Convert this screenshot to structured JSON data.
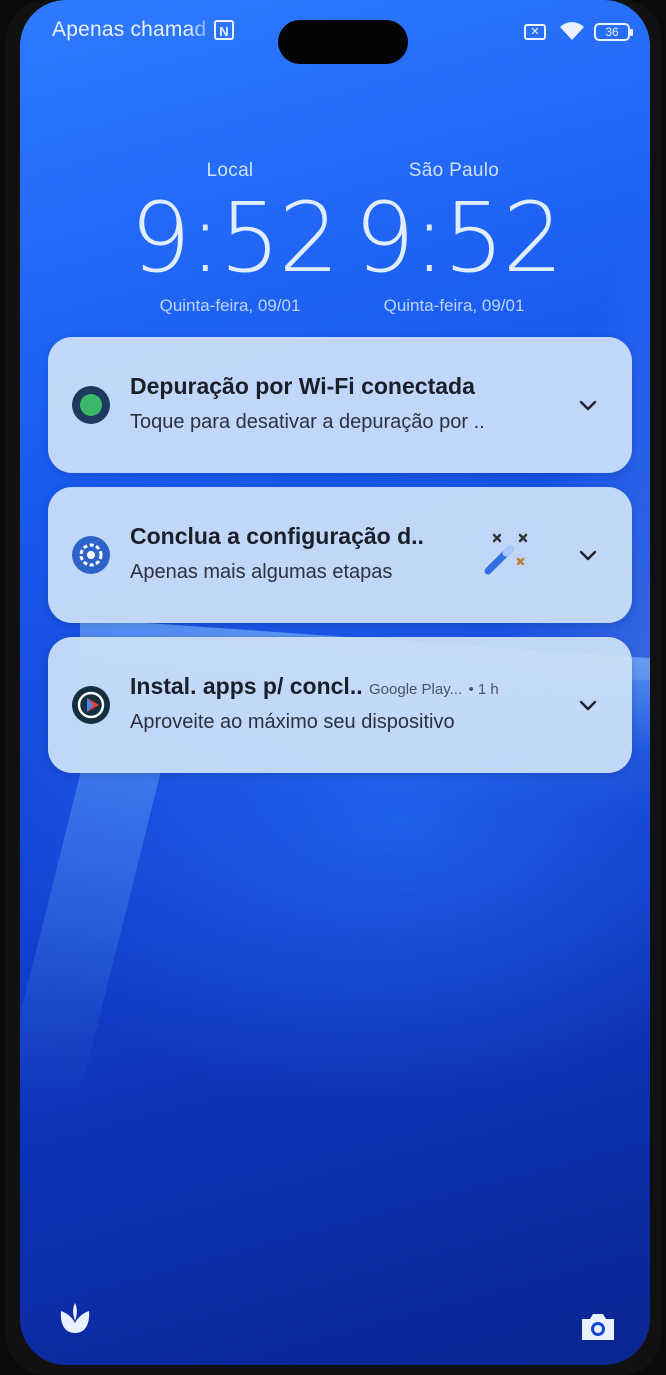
{
  "status_bar": {
    "carrier_text": "Apenas chamad",
    "nfc_label": "N",
    "battery_level": "36",
    "icons": [
      "nfc-icon",
      "sim-icon",
      "wifi-icon",
      "battery-icon"
    ]
  },
  "clocks": [
    {
      "city": "Local",
      "time": "9:52",
      "date": "Quinta-feira, 09/01"
    },
    {
      "city": "São Paulo",
      "time": "9:52",
      "date": "Quinta-feira, 09/01"
    }
  ],
  "notifications": [
    {
      "title": "Depuração por Wi-Fi conectada",
      "body": "Toque para desativar a depuração por ..",
      "icon": "android-debug-icon"
    },
    {
      "title": "Conclua a configuração d..",
      "body": "Apenas mais algumas etapas",
      "icon": "settings-gear-icon"
    },
    {
      "title": "Instal. apps p/ concl..",
      "app": "Google Play...",
      "time": "• 1 h",
      "body": "Aproveite ao máximo seu dispositivo",
      "icon": "google-play-icon"
    }
  ],
  "shortcuts": {
    "left": "flower-icon",
    "right": "camera-icon"
  },
  "colors": {
    "wallpaper_top": "#2f7bff",
    "wallpaper_bottom": "#0a2590",
    "card": "#cde1fa"
  }
}
